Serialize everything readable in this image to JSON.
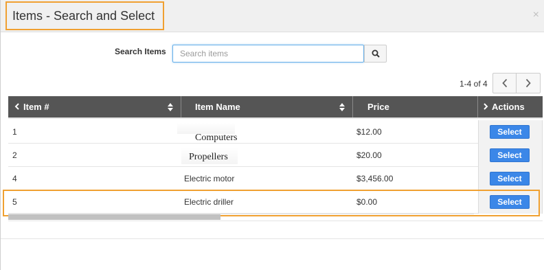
{
  "modal": {
    "title": "Items - Search and Select",
    "close_glyph": "×"
  },
  "search": {
    "label": "Search Items",
    "placeholder": "Search items",
    "value": "",
    "button_icon": "search-icon"
  },
  "pagination": {
    "range_text": "1-4 of 4",
    "prev_icon": "chevron-left-icon",
    "next_icon": "chevron-right-icon"
  },
  "table": {
    "columns": [
      {
        "label": "Item #",
        "sortable": true,
        "prefix_icon": "chevron-left-icon"
      },
      {
        "label": "Item Name",
        "sortable": true
      },
      {
        "label": "Price",
        "sortable": false
      },
      {
        "label": "Actions",
        "sortable": false,
        "prefix_icon": "chevron-right-icon"
      }
    ],
    "rows": [
      {
        "num": "1",
        "name": "Computers",
        "price": "$12.00",
        "action": "Select"
      },
      {
        "num": "2",
        "name": "Propellers",
        "price": "$20.00",
        "action": "Select"
      },
      {
        "num": "4",
        "name": "Electric motor",
        "price": "$3,456.00",
        "action": "Select"
      },
      {
        "num": "5",
        "name": "Electric driller",
        "price": "$0.00",
        "action": "Select"
      }
    ]
  },
  "colors": {
    "header_bg": "#555555",
    "select_button": "#3b87e8",
    "highlight": "#f0a030",
    "search_focus": "#66afe9"
  }
}
